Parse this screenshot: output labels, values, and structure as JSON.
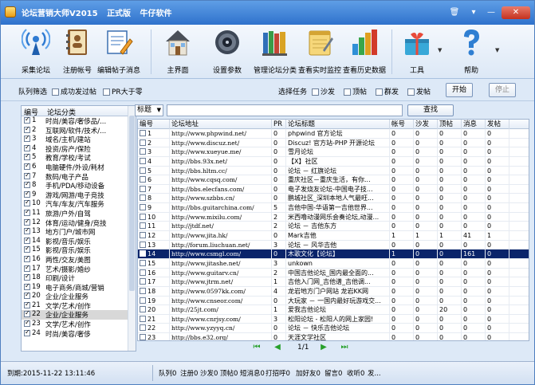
{
  "window": {
    "title_parts": [
      "论坛营销大师V2015",
      "正式版",
      "牛仔软件"
    ],
    "controls": {
      "trash": "🗑",
      "skin": "▾",
      "min": "—",
      "close": "✕"
    }
  },
  "toolbar": [
    {
      "label": "采集论坛",
      "icon": "antenna-icon"
    },
    {
      "label": "注册帐号",
      "icon": "address-book-icon"
    },
    {
      "label": "编辑帖子消息",
      "icon": "edit-message-icon"
    },
    {
      "label": "主界面",
      "icon": "house-icon"
    },
    {
      "label": "设置参数",
      "icon": "settings-icon"
    },
    {
      "label": "管理论坛分类",
      "icon": "folders-icon"
    },
    {
      "label": "查看实时监控",
      "icon": "notepad-icon"
    },
    {
      "label": "查看历史数据",
      "icon": "bar-chart-icon"
    },
    {
      "label": "工具",
      "icon": "toolbox-icon"
    },
    {
      "label": "帮助",
      "icon": "help-icon"
    }
  ],
  "filter": {
    "queue_label": "队列筛选",
    "success_label": "成功发过帖",
    "pr_label": "PR大于零",
    "task_label": "选择任务",
    "tasks": [
      "沙发",
      "顶帖",
      "群发",
      "发帖"
    ],
    "start_label": "开始",
    "stop_label": "停止"
  },
  "categories": {
    "headers": {
      "num": "编号",
      "name": "论坛分类"
    },
    "selected_index": 21,
    "rows": [
      {
        "num": "1",
        "name": "时尚/美容/奢侈品/..."
      },
      {
        "num": "2",
        "name": "互联网/软件/技术/..."
      },
      {
        "num": "3",
        "name": "域名/主机/建站"
      },
      {
        "num": "4",
        "name": "投资/房产/保险"
      },
      {
        "num": "5",
        "name": "教育/学校/考试"
      },
      {
        "num": "6",
        "name": "电脑硬件/外设/耗材"
      },
      {
        "num": "7",
        "name": "数码/电子产品"
      },
      {
        "num": "8",
        "name": "手机/PDA/移动设备"
      },
      {
        "num": "9",
        "name": "游戏/网游/电子竞技"
      },
      {
        "num": "10",
        "name": "汽车/车友/汽车服务"
      },
      {
        "num": "11",
        "name": "旅游/户外/自驾"
      },
      {
        "num": "12",
        "name": "体育/运动/健身/竞技"
      },
      {
        "num": "13",
        "name": "地方门户/城市网"
      },
      {
        "num": "14",
        "name": "影视/音乐/娱乐"
      },
      {
        "num": "15",
        "name": "影视/音乐/娱乐"
      },
      {
        "num": "16",
        "name": "两性/交友/美图"
      },
      {
        "num": "17",
        "name": "艺术/摄影/婚纱"
      },
      {
        "num": "18",
        "name": "印刷/设计"
      },
      {
        "num": "19",
        "name": "电子商务/商城/营销"
      },
      {
        "num": "20",
        "name": "企业/企业服务"
      },
      {
        "num": "21",
        "name": "文学/艺术/创作"
      },
      {
        "num": "22",
        "name": "企业/企业服务"
      },
      {
        "num": "23",
        "name": "文学/艺术/创作"
      },
      {
        "num": "24",
        "name": "时尚/美容/奢侈"
      }
    ]
  },
  "search": {
    "type": "标题",
    "button": "查找"
  },
  "grid": {
    "headers": [
      "编号",
      "论坛地址",
      "PR",
      "论坛标题",
      "帐号",
      "沙发",
      "顶帖",
      "消息",
      "发帖"
    ],
    "selected_index": 13,
    "rows": [
      [
        "1",
        "http://www.phpwind.net/",
        "0",
        "phpwind 官方论坛",
        "0",
        "0",
        "0",
        "0",
        "0"
      ],
      [
        "2",
        "http://www.discuz.net/",
        "0",
        "Discuz! 官方站-PHP 开源论坛",
        "0",
        "0",
        "0",
        "0",
        "0"
      ],
      [
        "3",
        "http://www.xueyue.me/",
        "0",
        "雪月论坛",
        "0",
        "0",
        "0",
        "0",
        "0"
      ],
      [
        "4",
        "http://bbs.93x.net/",
        "0",
        "【X】社区",
        "0",
        "0",
        "0",
        "0",
        "0"
      ],
      [
        "5",
        "http://bbs.hltm.cc/",
        "0",
        "论坛 － 红旗论坛",
        "0",
        "0",
        "0",
        "0",
        "0"
      ],
      [
        "6",
        "http://www.cqsq.com/",
        "0",
        "重庆社区－重庆生活，有你...",
        "0",
        "0",
        "0",
        "0",
        "0"
      ],
      [
        "7",
        "http://bbs.elecfans.com/",
        "0",
        "电子发烧友论坛-中国电子技...",
        "0",
        "0",
        "0",
        "0",
        "0"
      ],
      [
        "8",
        "http://www.szbbs.cn/",
        "0",
        "鹏城社区_深圳本地人气最旺...",
        "0",
        "0",
        "0",
        "0",
        "0"
      ],
      [
        "9",
        "http://bbs.guitarchina.com/",
        "5",
        "吉他中国-华语第一吉他世界...",
        "0",
        "0",
        "0",
        "0",
        "0"
      ],
      [
        "10",
        "http://www.mixilu.com/",
        "2",
        "米西噜动漫网乐会奏论坛,动漫...",
        "0",
        "0",
        "0",
        "0",
        "0"
      ],
      [
        "11",
        "http://jtdf.net/",
        "2",
        "论坛 － 吉他东方",
        "0",
        "0",
        "0",
        "0",
        "0"
      ],
      [
        "12",
        "http://www.jita.hk/",
        "0",
        "Mark吉他",
        "1",
        "1",
        "1",
        "41",
        "1"
      ],
      [
        "13",
        "http://forum.liuchuan.net/",
        "3",
        "论坛 － 风华吉他",
        "0",
        "0",
        "0",
        "0",
        "0"
      ],
      [
        "14",
        "http://www.csmgl.com/",
        "0",
        "木歌文化【论坛】",
        "1",
        "0",
        "0",
        "161",
        "0"
      ],
      [
        "15",
        "http://www.jitashe.net/",
        "3",
        "unkown",
        "0",
        "0",
        "0",
        "0",
        "0"
      ],
      [
        "16",
        "http://www.guitarv.cn/",
        "2",
        "中国吉他论坛_国内最全面的...",
        "0",
        "0",
        "0",
        "0",
        "0"
      ],
      [
        "17",
        "http://www.jtrm.net/",
        "1",
        "吉他入门网_吉他谱_吉他调...",
        "0",
        "0",
        "0",
        "0",
        "0"
      ],
      [
        "18",
        "http://www.0597kk.com/",
        "4",
        "龙岩地方门户网站 龙岩KK网",
        "0",
        "0",
        "0",
        "0",
        "0"
      ],
      [
        "19",
        "http://www.cnseor.com/",
        "0",
        "大玩家 － 一国内最好玩游戏交...",
        "0",
        "0",
        "0",
        "0",
        "0"
      ],
      [
        "20",
        "http://25jt.com/",
        "1",
        "爱我吉他论坛",
        "0",
        "0",
        "20",
        "0",
        "0"
      ],
      [
        "21",
        "http://www.cnrjsy.com/",
        "3",
        "松阳论坛 - 松阳人的网上家园!",
        "0",
        "0",
        "0",
        "0",
        "0"
      ],
      [
        "22",
        "http://www.yzyyq.cn/",
        "0",
        "论坛 － 快乐吉他论坛",
        "0",
        "0",
        "0",
        "0",
        "0"
      ],
      [
        "23",
        "http://bbs.e32.org/",
        "0",
        "天涯文学社区",
        "0",
        "0",
        "0",
        "0",
        "0"
      ]
    ]
  },
  "pager": {
    "info": "1/1"
  },
  "status": {
    "expire": "到期:2015-11-22 13:11:46",
    "queue": "队列0",
    "register": "注册0",
    "sofa": "沙发0",
    "bump": "顶帖0",
    "reply": "短消息0",
    "punch": "打招呼0",
    "friend": "加好友0",
    "message": "留言0",
    "collect": "收听0",
    "post": "发..."
  },
  "colors": {
    "title_bar": "#2f72cc",
    "selection": "#0a246a",
    "pager_arrows": "#27a02b"
  }
}
